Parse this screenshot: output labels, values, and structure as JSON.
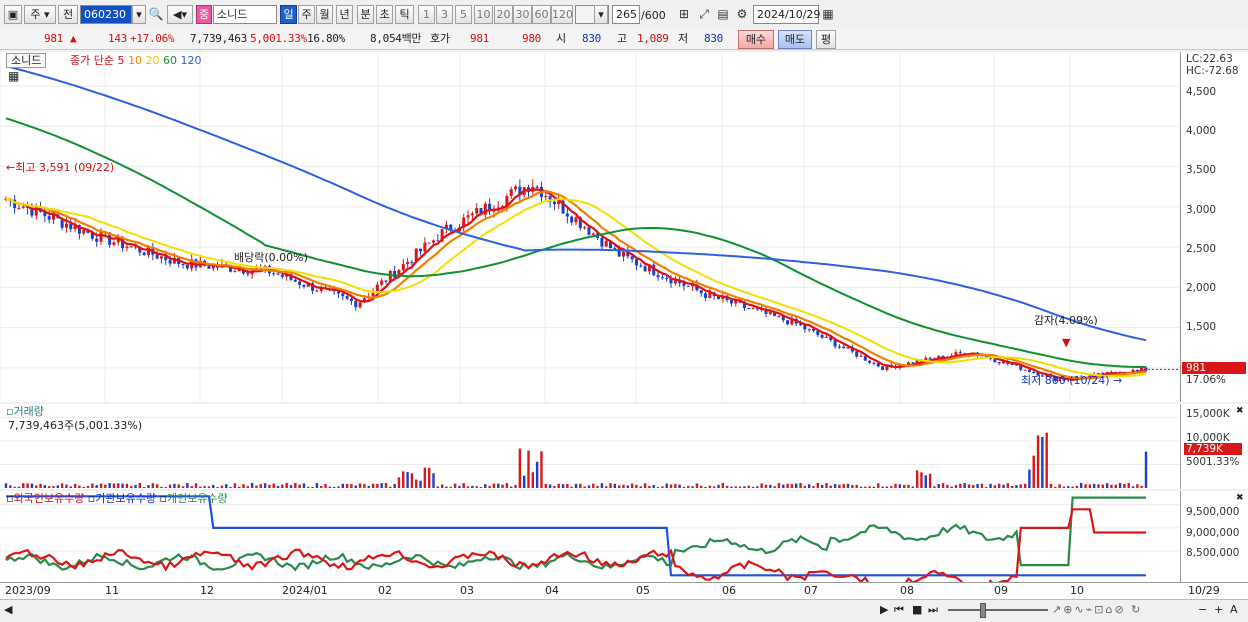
{
  "toolbar": {
    "period_short": "주",
    "mode": "전",
    "code": "060230",
    "market_badge": "증",
    "name": "소니드",
    "periods": [
      "일",
      "주",
      "월",
      "년",
      "분",
      "초",
      "틱"
    ],
    "intervals": [
      "1",
      "3",
      "5",
      "10",
      "20",
      "30",
      "60",
      "120"
    ],
    "count": "265",
    "count_max": "/600",
    "date": "2024/10/29"
  },
  "quote": {
    "price": "981",
    "change": "143",
    "change_pct": "+17.06%",
    "volume": "7,739,463",
    "volume_ratio": "5,001.33%",
    "turnover": "16.80%",
    "amount": "8,054백만",
    "ask_label": "호가",
    "ask": "981",
    "bid": "980",
    "open_label": "시",
    "open": "830",
    "high_label": "고",
    "high": "1,089",
    "low_label": "저",
    "low": "830",
    "buy_label": "매수",
    "sell_label": "매도",
    "eval_label": "평"
  },
  "price_pane": {
    "stock_tab": "소니드",
    "ma_label": "종가 단순",
    "ma_periods": [
      "5",
      "10",
      "20",
      "60",
      "120"
    ],
    "ma_colors": [
      "#e01010",
      "#f08000",
      "#f0e000",
      "#109030",
      "#3060e0"
    ],
    "lc": "LC:22.63",
    "hc": "HC:-72.68",
    "high_marker": "최고 3,591 (09/22)",
    "low_marker": "최저 800 (10/24)",
    "dividend_marker": "배당락(0.00%)",
    "reduction_marker": "감자(4.09%)",
    "current_price": "981",
    "current_pct": "17.06%",
    "y_ticks": [
      "4,500",
      "4,000",
      "3,500",
      "3,000",
      "2,500",
      "2,000",
      "1,500"
    ]
  },
  "volume_pane": {
    "title": "거래량",
    "value": "7,739,463주(5,001.33%)",
    "y_ticks": [
      "15,000K",
      "10,000K"
    ],
    "current": "7,739K",
    "current_pct": "5001.33%"
  },
  "holding_pane": {
    "foreign": "외국인보유수량",
    "institution": "기관보유수량",
    "individual": "개인보유수량",
    "y_ticks": [
      "9,500,000",
      "9,000,000",
      "8,500,000"
    ]
  },
  "x_axis": {
    "labels": [
      "2023/09",
      "11",
      "12",
      "2024/01",
      "02",
      "03",
      "04",
      "05",
      "06",
      "07",
      "08",
      "09",
      "10"
    ],
    "right_label": "10/29"
  },
  "chart_data": {
    "type": "line",
    "title": "소니드",
    "x": [
      "2023/09",
      "11",
      "12",
      "2024/01",
      "02",
      "03",
      "04",
      "05",
      "06",
      "07",
      "08",
      "09",
      "10",
      "10/29"
    ],
    "close_approx": [
      3100,
      2650,
      2300,
      2200,
      1800,
      2700,
      3300,
      2400,
      1900,
      1550,
      1000,
      1200,
      850,
      981
    ],
    "high": {
      "value": 3591,
      "date": "09/22"
    },
    "low": {
      "value": 800,
      "date": "10/24"
    },
    "ylim": [
      700,
      4800
    ]
  }
}
